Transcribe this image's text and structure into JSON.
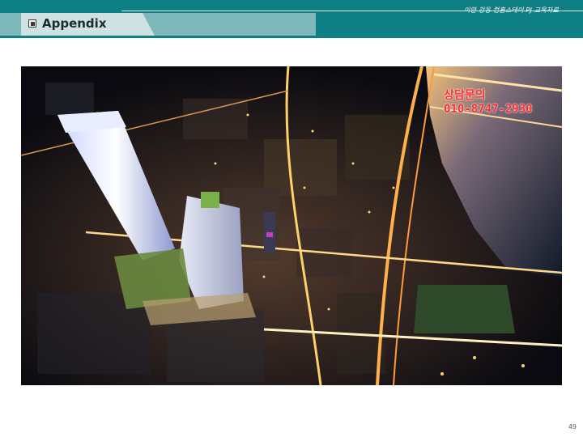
{
  "header": {
    "title": "Appendix",
    "subtitle": "이안 강동 컴홈스테이 PJ 교육자료"
  },
  "photo": {
    "description_icon": "night-aerial-city-render",
    "overlay": {
      "line1": "상담문의",
      "line2": "010-8747-2930"
    }
  },
  "footer": {
    "page_number": "49"
  },
  "colors": {
    "header_bg": "#0f7f86",
    "title_panel": "#7fb8bb",
    "title_box": "#cfe2e3",
    "overlay_text": "#ff2a2a"
  }
}
